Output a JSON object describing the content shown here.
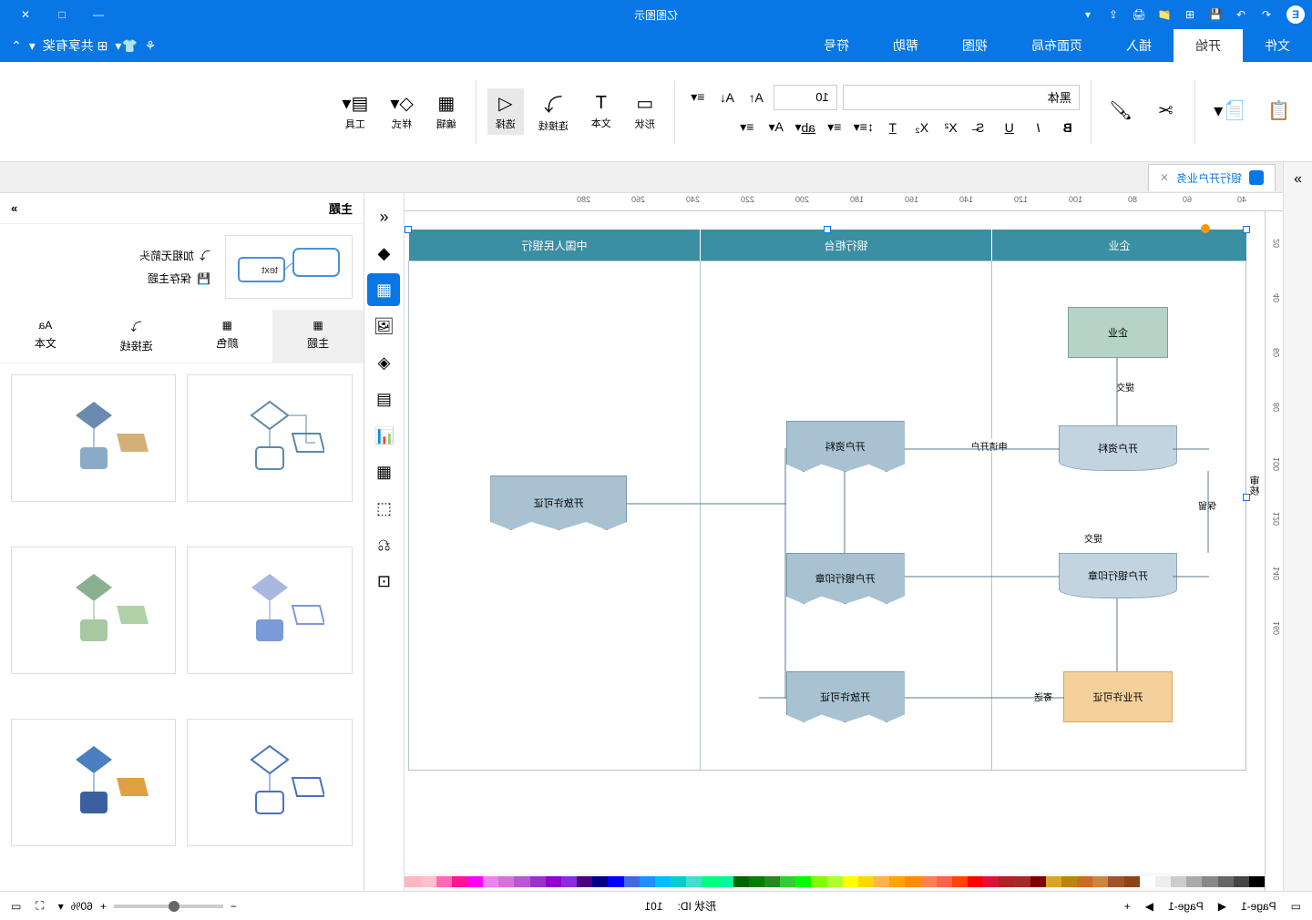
{
  "titlebar": {
    "app_title": "亿图图示",
    "icons": [
      "undo",
      "redo",
      "save",
      "new",
      "open",
      "print",
      "export"
    ],
    "dropdown": "▾"
  },
  "menubar": {
    "items": [
      "文件",
      "开始",
      "插入",
      "页面布局",
      "视图",
      "帮助",
      "符号"
    ],
    "active_index": 1
  },
  "ribbon": {
    "font_name": "黑体",
    "font_size": "10",
    "buttons": {
      "paste": "粘贴",
      "cut": "剪切",
      "format_painter": "格式",
      "bold": "B",
      "italic": "I",
      "underline": "U",
      "shape": "形状",
      "text": "文本",
      "connector": "连接线",
      "select": "选择",
      "edit": "编辑",
      "style": "样式",
      "tool": "工具"
    }
  },
  "doc_tab": {
    "title": "银行开户业务"
  },
  "ruler_h": [
    "40",
    "60",
    "80",
    "100",
    "120",
    "140",
    "160",
    "180",
    "200",
    "220",
    "240",
    "260",
    "280"
  ],
  "ruler_v": [
    "20",
    "40",
    "60",
    "80",
    "100",
    "120",
    "140",
    "160"
  ],
  "swimlane": {
    "side_label": "审核",
    "lanes": [
      "企业",
      "银行柜台",
      "中国人民银行"
    ],
    "shapes": {
      "enterprise": "企业",
      "open_material1": "开户资料",
      "open_material2": "开户资料",
      "bank_seal1": "开户银行印章",
      "bank_seal2": "开户银行印章",
      "business_license": "开业许可证",
      "license_copy": "开放许可证",
      "license_copy2": "开放许可证"
    },
    "edges": {
      "submit1": "提交",
      "apply_open": "申请开户",
      "keep": "保留",
      "submit2": "提交",
      "send": "寄送"
    }
  },
  "theme_panel": {
    "title": "主题",
    "collapse": "»",
    "preview_text": "text",
    "actions": {
      "add_arrow": "加粗无箭头",
      "save_theme": "保存主题"
    },
    "tabs": [
      "主题",
      "颜色",
      "连接线",
      "文本"
    ],
    "active_tab": 0
  },
  "statusbar": {
    "page_label1": "Page-1",
    "page_label2": "Page-1",
    "shape_id_label": "形状 ID:",
    "shape_id_value": "101",
    "zoom": "60%"
  },
  "colors": [
    "#000",
    "#444",
    "#666",
    "#888",
    "#aaa",
    "#ccc",
    "#eee",
    "#fff",
    "#8b4513",
    "#a0522d",
    "#cd853f",
    "#d2691e",
    "#b8860b",
    "#daa520",
    "#800000",
    "#a52a2a",
    "#b22222",
    "#dc143c",
    "#ff0000",
    "#ff4500",
    "#ff6347",
    "#ff7f50",
    "#ff8c00",
    "#ffa500",
    "#ffb347",
    "#ffd700",
    "#ffff00",
    "#adff2f",
    "#7fff00",
    "#00ff00",
    "#32cd32",
    "#228b22",
    "#008000",
    "#006400",
    "#00fa9a",
    "#00ff7f",
    "#40e0d0",
    "#00ced1",
    "#00bfff",
    "#1e90ff",
    "#4169e1",
    "#0000ff",
    "#00008b",
    "#4b0082",
    "#8a2be2",
    "#9400d3",
    "#9932cc",
    "#ba55d3",
    "#da70d6",
    "#ee82ee",
    "#ff00ff",
    "#ff1493",
    "#ff69b4",
    "#ffc0cb",
    "#ffb6c1"
  ]
}
